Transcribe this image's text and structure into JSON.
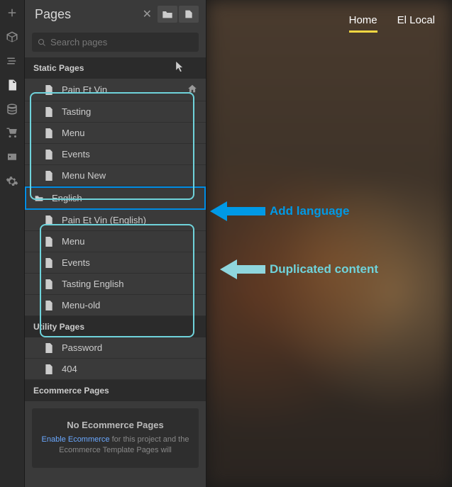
{
  "panel": {
    "title": "Pages",
    "search_placeholder": "Search pages"
  },
  "sections": {
    "static": "Static Pages",
    "utility": "Utility Pages",
    "ecommerce": "Ecommerce Pages"
  },
  "static_pages_group1": [
    {
      "label": "Pain Et Vin",
      "home": true
    },
    {
      "label": "Tasting"
    },
    {
      "label": "Menu"
    },
    {
      "label": "Events"
    },
    {
      "label": "Menu New"
    }
  ],
  "folder": {
    "label": "English"
  },
  "static_pages_group2": [
    {
      "label": "Pain Et Vin (English)"
    },
    {
      "label": "Menu"
    },
    {
      "label": "Events"
    },
    {
      "label": "Tasting English"
    },
    {
      "label": "Menu-old"
    }
  ],
  "utility_pages": [
    {
      "label": "Password"
    },
    {
      "label": "404"
    }
  ],
  "ecom_empty": {
    "title": "No Ecommerce Pages",
    "link": "Enable Ecommerce",
    "rest": " for this project and the Ecommerce Template Pages will"
  },
  "nav": {
    "home": "Home",
    "el_local": "El Local"
  },
  "annotations": {
    "add_language": "Add language",
    "duplicated": "Duplicated content"
  }
}
